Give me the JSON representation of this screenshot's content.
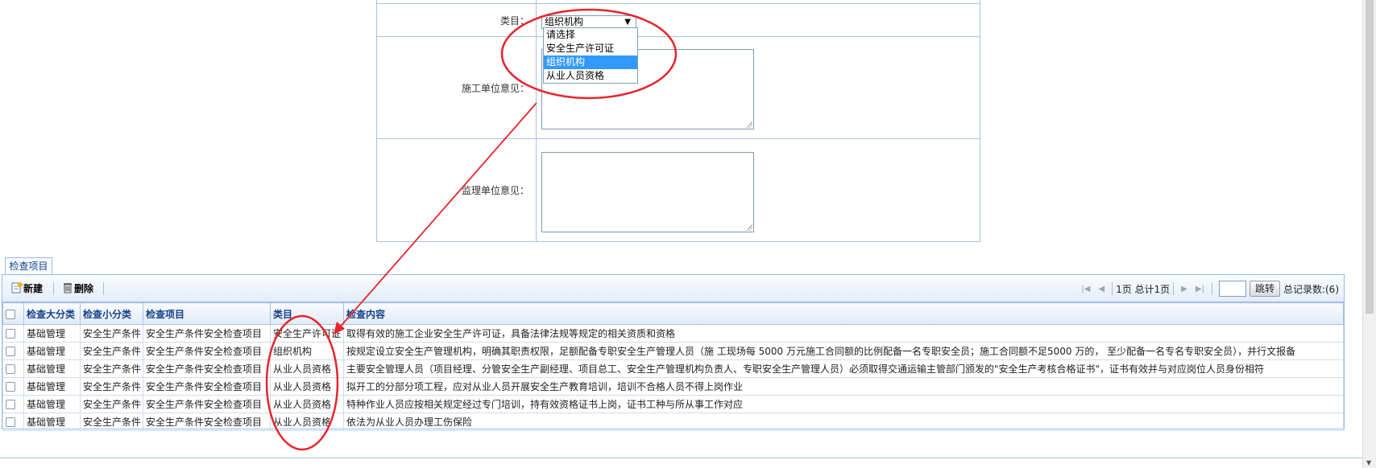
{
  "form": {
    "category_label": "类目：",
    "category_selected": "组织机构",
    "category_options": [
      "请选择",
      "安全生产许可证",
      "组织机构",
      "从业人员资格"
    ],
    "contractor_opinion_label": "施工单位意见：",
    "supervisor_opinion_label": "监理单位意见："
  },
  "tab": {
    "label": "检查项目"
  },
  "toolbar": {
    "new_label": "新建",
    "delete_label": "删除"
  },
  "pager": {
    "page_info": "1页 总计1页",
    "goto_label": "跳转",
    "total_label": "总记录数:(6)"
  },
  "grid": {
    "headers": [
      "检查大分类",
      "检查小分类",
      "检查项目",
      "类目",
      "检查内容"
    ],
    "rows": [
      [
        "基础管理",
        "安全生产条件",
        "安全生产条件安全检查项目",
        "安全生产许可证",
        "取得有效的施工企业安全生产许可证，具备法律法规等规定的相关资质和资格"
      ],
      [
        "基础管理",
        "安全生产条件",
        "安全生产条件安全检查项目",
        "组织机构",
        "按规定设立安全生产管理机构，明确其职责权限，足额配备专职安全生产管理人员（施 工现场每 5000 万元施工合同额的比例配备一名专职安全员；施工合同额不足5000 万的， 至少配备一名专名专职安全员），并行文报备"
      ],
      [
        "基础管理",
        "安全生产条件",
        "安全生产条件安全检查项目",
        "从业人员资格",
        "主要安全管理人员（项目经理、分管安全生产副经理、项目总工、安全生产管理机构负责人、专职安全生产管理人员）必须取得交通运输主管部门颁发的\"安全生产考核合格证书\"，证书有效并与对应岗位人员身份相符"
      ],
      [
        "基础管理",
        "安全生产条件",
        "安全生产条件安全检查项目",
        "从业人员资格",
        "拟开工的分部分项工程，应对从业人员开展安全生产教育培训，培训不合格人员不得上岗作业"
      ],
      [
        "基础管理",
        "安全生产条件",
        "安全生产条件安全检查项目",
        "从业人员资格",
        "特种作业人员应按相关规定经过专门培训，持有效资格证书上岗，证书工种与所从事工作对应"
      ],
      [
        "基础管理",
        "安全生产条件",
        "安全生产条件安全检查项目",
        "从业人员资格",
        "依法为从业人员办理工伤保险"
      ]
    ]
  },
  "colors": {
    "annotation": "#e8242c",
    "header_text": "#15428b",
    "border": "#99bbe8",
    "selected_option": "#3399ff"
  }
}
